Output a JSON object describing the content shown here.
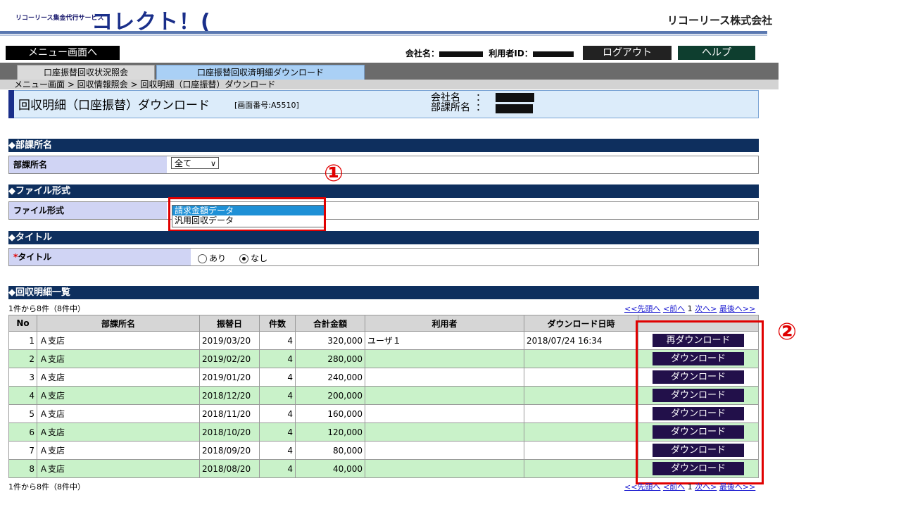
{
  "header": {
    "logo_small": "リコーリース集金代行サービス",
    "logo_big": "コレクト！(",
    "company": "リコーリース株式会社"
  },
  "topbar": {
    "menu_label": "メニュー画面へ",
    "company_label": "会社名：",
    "user_label": "利用者ID：",
    "logout_label": "ログアウト",
    "help_label": "ヘルプ"
  },
  "tabs": [
    {
      "label": "口座振替回収状況照会"
    },
    {
      "label": "口座振替回収済明細ダウンロード"
    }
  ],
  "breadcrumb": "メニュー画面 > 回収情報照会 > 回収明細（口座振替）ダウンロード",
  "page": {
    "title": "回収明細（口座振替）ダウンロード",
    "screen_id": "[画面番号:A5510]",
    "company_label": "会社名",
    "dept_label": "部課所名",
    "colon": "：\n："
  },
  "sections": {
    "dept": {
      "header": "◆部課所名",
      "label": "部課所名",
      "select_value": "全て",
      "chevron": "∨"
    },
    "format": {
      "header": "◆ファイル形式",
      "label": "ファイル形式",
      "options": [
        "請求金額データ",
        "汎用回収データ"
      ],
      "selected_index": 0
    },
    "title": {
      "header": "◆タイトル",
      "label": "タイトル",
      "required_mark": "*",
      "radio_yes": "あり",
      "radio_no": "なし",
      "selected": "なし"
    },
    "list": {
      "header": "◆回収明細一覧"
    }
  },
  "annotations": {
    "circle1": "①",
    "circle2": "②"
  },
  "pagination": {
    "count_text": "1件から8件（8件中）",
    "first": "<<先頭へ",
    "prev": "<前へ",
    "current": "1",
    "next": "次へ>",
    "last": "最後へ>>"
  },
  "table": {
    "columns": [
      "No",
      "部課所名",
      "振替日",
      "件数",
      "合計金額",
      "利用者",
      "ダウンロード日時",
      ""
    ],
    "rows": [
      {
        "no": "1",
        "dept": "Ａ支店",
        "date": "2019/03/20",
        "count": "4",
        "amount": "320,000",
        "user": "ユーザ１",
        "downloaded": "2018/07/24 16:34",
        "button": "再ダウンロード"
      },
      {
        "no": "2",
        "dept": "Ａ支店",
        "date": "2019/02/20",
        "count": "4",
        "amount": "280,000",
        "user": "",
        "downloaded": "",
        "button": "ダウンロード"
      },
      {
        "no": "3",
        "dept": "Ａ支店",
        "date": "2019/01/20",
        "count": "4",
        "amount": "240,000",
        "user": "",
        "downloaded": "",
        "button": "ダウンロード"
      },
      {
        "no": "4",
        "dept": "Ａ支店",
        "date": "2018/12/20",
        "count": "4",
        "amount": "200,000",
        "user": "",
        "downloaded": "",
        "button": "ダウンロード"
      },
      {
        "no": "5",
        "dept": "Ａ支店",
        "date": "2018/11/20",
        "count": "4",
        "amount": "160,000",
        "user": "",
        "downloaded": "",
        "button": "ダウンロード"
      },
      {
        "no": "6",
        "dept": "Ａ支店",
        "date": "2018/10/20",
        "count": "4",
        "amount": "120,000",
        "user": "",
        "downloaded": "",
        "button": "ダウンロード"
      },
      {
        "no": "7",
        "dept": "Ａ支店",
        "date": "2018/09/20",
        "count": "4",
        "amount": "80,000",
        "user": "",
        "downloaded": "",
        "button": "ダウンロード"
      },
      {
        "no": "8",
        "dept": "Ａ支店",
        "date": "2018/08/20",
        "count": "4",
        "amount": "40,000",
        "user": "",
        "downloaded": "",
        "button": "ダウンロード"
      }
    ]
  },
  "colors": {
    "section_bg": "#0e2f5e",
    "row_green": "#c9f2c9",
    "annotation_red": "#e00000",
    "download_btn": "#22104a"
  }
}
